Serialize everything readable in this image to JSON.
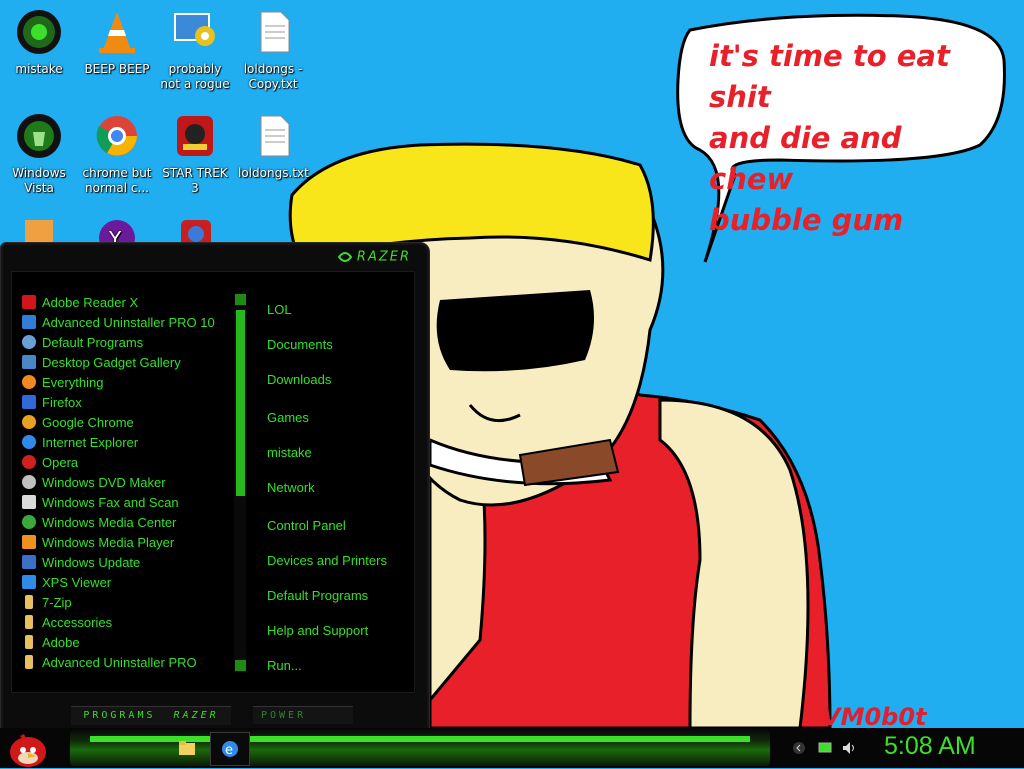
{
  "desktop": {
    "icons": [
      {
        "label": "mistake",
        "icon": "razer-orb-icon"
      },
      {
        "label": "BEEP BEEP",
        "icon": "vlc-cone-icon"
      },
      {
        "label": "probably not a rogue",
        "icon": "settings-monitor-icon"
      },
      {
        "label": "loldongs - Copy.txt",
        "icon": "text-file-icon"
      },
      {
        "label": "Windows Vista",
        "icon": "recycle-bin-icon"
      },
      {
        "label": "chrome but normal c...",
        "icon": "chrome-icon"
      },
      {
        "label": "STAR TREK 3",
        "icon": "angry-birds-star-wars-icon"
      },
      {
        "label": "loldongs.txt",
        "icon": "text-file-icon"
      },
      {
        "label": "",
        "icon": "folder-icon"
      },
      {
        "label": "",
        "icon": "yahoo-icon"
      },
      {
        "label": "",
        "icon": "app-icon"
      }
    ],
    "speech_lines": [
      "it's time to eat shit",
      "and die and chew",
      "bubble gum"
    ],
    "signature": "VM0b0t"
  },
  "start_menu": {
    "brand": "RAZER",
    "programs": [
      {
        "label": "Adobe Reader X",
        "color": "#d0161b"
      },
      {
        "label": "Advanced Uninstaller PRO 10",
        "color": "#2f7fd8"
      },
      {
        "label": "Default Programs",
        "color": "#6aa0d8"
      },
      {
        "label": "Desktop Gadget Gallery",
        "color": "#4a86c8"
      },
      {
        "label": "Everything",
        "color": "#f08a20"
      },
      {
        "label": "Firefox",
        "color": "#2f6ad8"
      },
      {
        "label": "Google Chrome",
        "color": "#e8a020"
      },
      {
        "label": "Internet Explorer",
        "color": "#2f8ae8"
      },
      {
        "label": "Opera",
        "color": "#d02020"
      },
      {
        "label": "Windows DVD Maker",
        "color": "#c0c0c0"
      },
      {
        "label": "Windows Fax and Scan",
        "color": "#dadada"
      },
      {
        "label": "Windows Media Center",
        "color": "#3aa83a"
      },
      {
        "label": "Windows Media Player",
        "color": "#f09020"
      },
      {
        "label": "Windows Update",
        "color": "#3a70c8"
      },
      {
        "label": "XPS Viewer",
        "color": "#2f8ae8"
      },
      {
        "label": "7-Zip",
        "color": "#e8c060"
      },
      {
        "label": "Accessories",
        "color": "#e8c060"
      },
      {
        "label": "Adobe",
        "color": "#e8c060"
      },
      {
        "label": "Advanced Uninstaller PRO",
        "color": "#e8c060"
      }
    ],
    "places": [
      "LOL",
      "Documents",
      "Downloads",
      "Games",
      "mistake",
      "Network",
      "Control Panel",
      "Devices and Printers",
      "Default Programs",
      "Help and Support",
      "Run..."
    ],
    "programs_button": "PROGRAMS",
    "programs_brand": "RAZER",
    "power_button": "POWER"
  },
  "taskbar": {
    "clock": "5:08 AM",
    "start_icon": "angry-bird-icon",
    "pinned": [
      "folder-icon",
      "internet-explorer-icon"
    ],
    "tray": [
      "chevron-icon",
      "network-icon",
      "volume-icon"
    ]
  }
}
